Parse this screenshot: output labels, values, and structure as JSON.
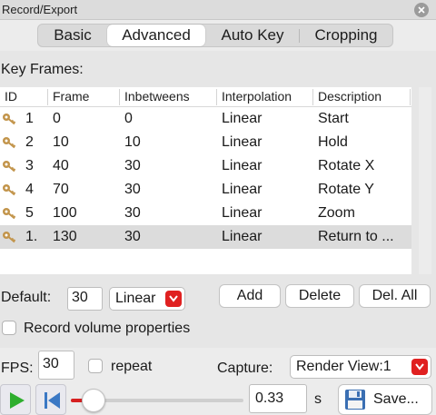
{
  "window": {
    "title": "Record/Export"
  },
  "tabs": [
    {
      "label": "Basic",
      "active": false
    },
    {
      "label": "Advanced",
      "active": true
    },
    {
      "label": "Auto Key",
      "active": false
    },
    {
      "label": "Cropping",
      "active": false
    }
  ],
  "keyframes": {
    "section_label": "Key Frames:",
    "columns": [
      "ID",
      "Frame",
      "Inbetweens",
      "Interpolation",
      "Description"
    ],
    "rows": [
      {
        "id": "1",
        "frame": "0",
        "inbetweens": "0",
        "interpolation": "Linear",
        "description": "Start",
        "selected": false
      },
      {
        "id": "2",
        "frame": "10",
        "inbetweens": "10",
        "interpolation": "Linear",
        "description": "Hold",
        "selected": false
      },
      {
        "id": "3",
        "frame": "40",
        "inbetweens": "30",
        "interpolation": "Linear",
        "description": "Rotate X",
        "selected": false
      },
      {
        "id": "4",
        "frame": "70",
        "inbetweens": "30",
        "interpolation": "Linear",
        "description": "Rotate Y",
        "selected": false
      },
      {
        "id": "5",
        "frame": "100",
        "inbetweens": "30",
        "interpolation": "Linear",
        "description": "Zoom",
        "selected": false
      },
      {
        "id": "1.",
        "frame": "130",
        "inbetweens": "30",
        "interpolation": "Linear",
        "description": "Return to ...",
        "selected": true
      }
    ]
  },
  "defaults": {
    "label": "Default:",
    "inbetweens_value": "30",
    "interpolation_value": "Linear",
    "add_label": "Add",
    "delete_label": "Delete",
    "delete_all_label": "Del. All"
  },
  "record_volume": {
    "label": "Record volume properties",
    "checked": false
  },
  "playback": {
    "fps_label": "FPS:",
    "fps_value": "30",
    "repeat_label": "repeat",
    "repeat_checked": false,
    "capture_label": "Capture:",
    "capture_value": "Render View:1",
    "duration_value": "0.33",
    "duration_unit": "s",
    "save_label": "Save...",
    "position_fraction": 0.13
  },
  "colors": {
    "accent_red": "#e02020",
    "play_green": "#2eae2e",
    "rewind_blue": "#3b78c4",
    "key_icon": "#c2944a"
  },
  "icons": {
    "close": "close-icon",
    "key": "key-icon",
    "dropdown": "chevron-down-icon",
    "play": "play-icon",
    "rewind": "rewind-to-start-icon",
    "save": "floppy-disk-icon"
  }
}
